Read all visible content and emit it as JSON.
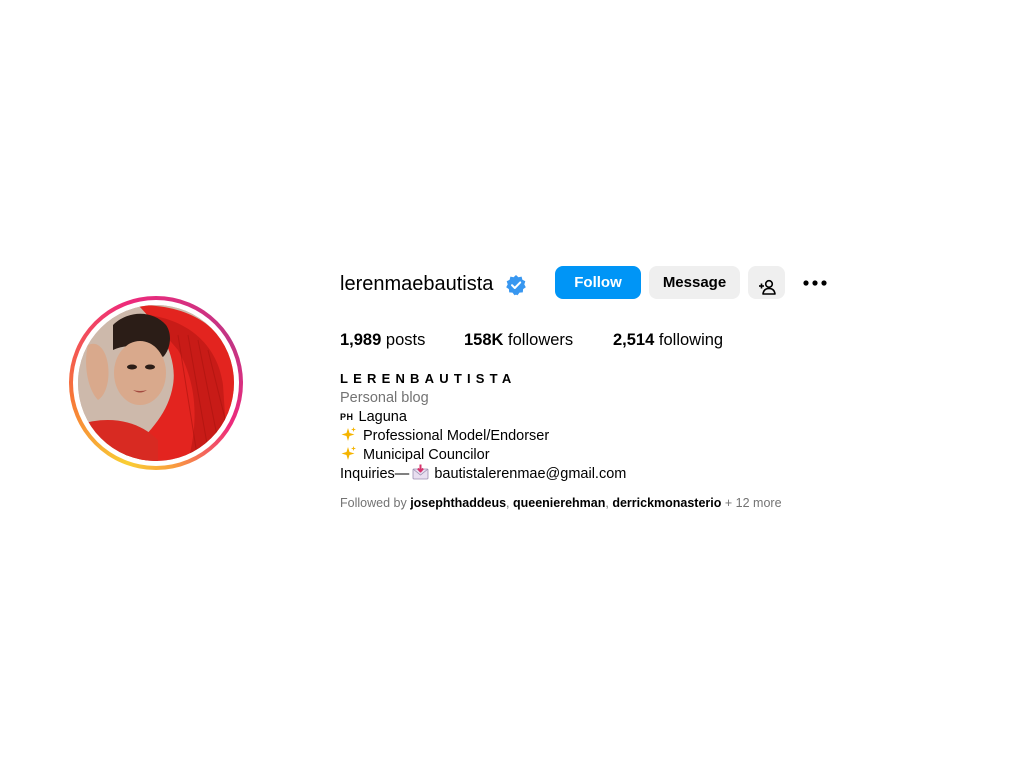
{
  "profile": {
    "username": "lerenmaebautista",
    "verified": true,
    "avatar_description": "profile photo"
  },
  "actions": {
    "follow_label": "Follow",
    "message_label": "Message",
    "add_user_icon": "add-user-icon",
    "more_icon": "more-options-icon"
  },
  "stats": {
    "posts_count": "1,989",
    "posts_label": "posts",
    "followers_count": "158K",
    "followers_label": "followers",
    "following_count": "2,514",
    "following_label": "following"
  },
  "bio": {
    "display_name": "LERENBAUTISTA",
    "category": "Personal blog",
    "location_flag": "PH",
    "location": "Laguna",
    "line_model": "Professional Model/Endorser",
    "line_council": "Municipal Councilor",
    "inquiries_label": "Inquiries—",
    "email": "bautistalerenmae@gmail.com"
  },
  "followed_by": {
    "prefix": "Followed by",
    "users": [
      "josephthaddeus",
      "queenierehman",
      "derrickmonasterio"
    ],
    "more": "+ 12 more"
  },
  "colors": {
    "follow_button": "#0095f6",
    "secondary_button": "#efefef",
    "verified_badge": "#3897f0",
    "muted_text": "#737373"
  }
}
